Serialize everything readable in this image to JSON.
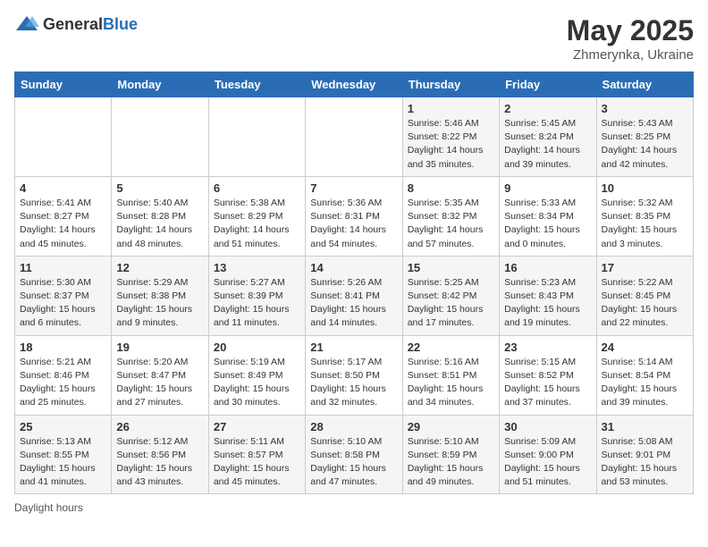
{
  "header": {
    "logo_general": "General",
    "logo_blue": "Blue",
    "month_year": "May 2025",
    "location": "Zhmerynka, Ukraine"
  },
  "days_of_week": [
    "Sunday",
    "Monday",
    "Tuesday",
    "Wednesday",
    "Thursday",
    "Friday",
    "Saturday"
  ],
  "weeks": [
    [
      {
        "day": "",
        "info": ""
      },
      {
        "day": "",
        "info": ""
      },
      {
        "day": "",
        "info": ""
      },
      {
        "day": "",
        "info": ""
      },
      {
        "day": "1",
        "info": "Sunrise: 5:46 AM\nSunset: 8:22 PM\nDaylight: 14 hours\nand 35 minutes."
      },
      {
        "day": "2",
        "info": "Sunrise: 5:45 AM\nSunset: 8:24 PM\nDaylight: 14 hours\nand 39 minutes."
      },
      {
        "day": "3",
        "info": "Sunrise: 5:43 AM\nSunset: 8:25 PM\nDaylight: 14 hours\nand 42 minutes."
      }
    ],
    [
      {
        "day": "4",
        "info": "Sunrise: 5:41 AM\nSunset: 8:27 PM\nDaylight: 14 hours\nand 45 minutes."
      },
      {
        "day": "5",
        "info": "Sunrise: 5:40 AM\nSunset: 8:28 PM\nDaylight: 14 hours\nand 48 minutes."
      },
      {
        "day": "6",
        "info": "Sunrise: 5:38 AM\nSunset: 8:29 PM\nDaylight: 14 hours\nand 51 minutes."
      },
      {
        "day": "7",
        "info": "Sunrise: 5:36 AM\nSunset: 8:31 PM\nDaylight: 14 hours\nand 54 minutes."
      },
      {
        "day": "8",
        "info": "Sunrise: 5:35 AM\nSunset: 8:32 PM\nDaylight: 14 hours\nand 57 minutes."
      },
      {
        "day": "9",
        "info": "Sunrise: 5:33 AM\nSunset: 8:34 PM\nDaylight: 15 hours\nand 0 minutes."
      },
      {
        "day": "10",
        "info": "Sunrise: 5:32 AM\nSunset: 8:35 PM\nDaylight: 15 hours\nand 3 minutes."
      }
    ],
    [
      {
        "day": "11",
        "info": "Sunrise: 5:30 AM\nSunset: 8:37 PM\nDaylight: 15 hours\nand 6 minutes."
      },
      {
        "day": "12",
        "info": "Sunrise: 5:29 AM\nSunset: 8:38 PM\nDaylight: 15 hours\nand 9 minutes."
      },
      {
        "day": "13",
        "info": "Sunrise: 5:27 AM\nSunset: 8:39 PM\nDaylight: 15 hours\nand 11 minutes."
      },
      {
        "day": "14",
        "info": "Sunrise: 5:26 AM\nSunset: 8:41 PM\nDaylight: 15 hours\nand 14 minutes."
      },
      {
        "day": "15",
        "info": "Sunrise: 5:25 AM\nSunset: 8:42 PM\nDaylight: 15 hours\nand 17 minutes."
      },
      {
        "day": "16",
        "info": "Sunrise: 5:23 AM\nSunset: 8:43 PM\nDaylight: 15 hours\nand 19 minutes."
      },
      {
        "day": "17",
        "info": "Sunrise: 5:22 AM\nSunset: 8:45 PM\nDaylight: 15 hours\nand 22 minutes."
      }
    ],
    [
      {
        "day": "18",
        "info": "Sunrise: 5:21 AM\nSunset: 8:46 PM\nDaylight: 15 hours\nand 25 minutes."
      },
      {
        "day": "19",
        "info": "Sunrise: 5:20 AM\nSunset: 8:47 PM\nDaylight: 15 hours\nand 27 minutes."
      },
      {
        "day": "20",
        "info": "Sunrise: 5:19 AM\nSunset: 8:49 PM\nDaylight: 15 hours\nand 30 minutes."
      },
      {
        "day": "21",
        "info": "Sunrise: 5:17 AM\nSunset: 8:50 PM\nDaylight: 15 hours\nand 32 minutes."
      },
      {
        "day": "22",
        "info": "Sunrise: 5:16 AM\nSunset: 8:51 PM\nDaylight: 15 hours\nand 34 minutes."
      },
      {
        "day": "23",
        "info": "Sunrise: 5:15 AM\nSunset: 8:52 PM\nDaylight: 15 hours\nand 37 minutes."
      },
      {
        "day": "24",
        "info": "Sunrise: 5:14 AM\nSunset: 8:54 PM\nDaylight: 15 hours\nand 39 minutes."
      }
    ],
    [
      {
        "day": "25",
        "info": "Sunrise: 5:13 AM\nSunset: 8:55 PM\nDaylight: 15 hours\nand 41 minutes."
      },
      {
        "day": "26",
        "info": "Sunrise: 5:12 AM\nSunset: 8:56 PM\nDaylight: 15 hours\nand 43 minutes."
      },
      {
        "day": "27",
        "info": "Sunrise: 5:11 AM\nSunset: 8:57 PM\nDaylight: 15 hours\nand 45 minutes."
      },
      {
        "day": "28",
        "info": "Sunrise: 5:10 AM\nSunset: 8:58 PM\nDaylight: 15 hours\nand 47 minutes."
      },
      {
        "day": "29",
        "info": "Sunrise: 5:10 AM\nSunset: 8:59 PM\nDaylight: 15 hours\nand 49 minutes."
      },
      {
        "day": "30",
        "info": "Sunrise: 5:09 AM\nSunset: 9:00 PM\nDaylight: 15 hours\nand 51 minutes."
      },
      {
        "day": "31",
        "info": "Sunrise: 5:08 AM\nSunset: 9:01 PM\nDaylight: 15 hours\nand 53 minutes."
      }
    ]
  ],
  "footer": {
    "daylight_hours_label": "Daylight hours"
  }
}
